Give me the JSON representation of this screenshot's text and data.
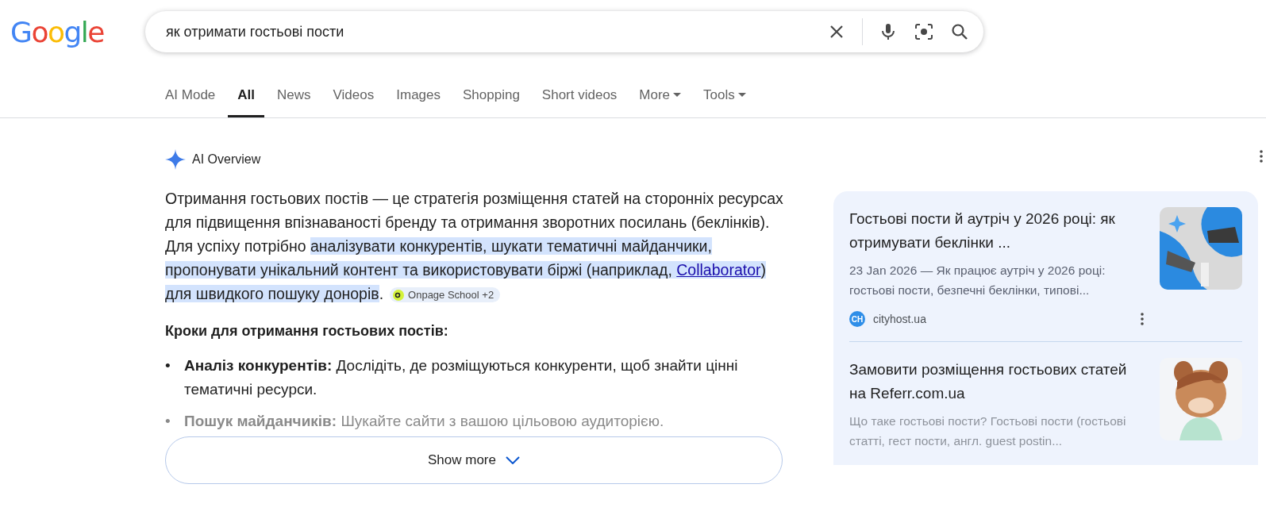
{
  "logo": [
    {
      "letter": "G",
      "color": "#4285f4"
    },
    {
      "letter": "o",
      "color": "#ea4335"
    },
    {
      "letter": "o",
      "color": "#fbbc05"
    },
    {
      "letter": "g",
      "color": "#4285f4"
    },
    {
      "letter": "l",
      "color": "#34a853"
    },
    {
      "letter": "e",
      "color": "#ea4335"
    }
  ],
  "search": {
    "value": "як отримати гостьові пости"
  },
  "tabs": [
    {
      "label": "AI Mode",
      "selected": false,
      "dropdown": false
    },
    {
      "label": "All",
      "selected": true,
      "dropdown": false
    },
    {
      "label": "News",
      "selected": false,
      "dropdown": false
    },
    {
      "label": "Videos",
      "selected": false,
      "dropdown": false
    },
    {
      "label": "Images",
      "selected": false,
      "dropdown": false
    },
    {
      "label": "Shopping",
      "selected": false,
      "dropdown": false
    },
    {
      "label": "Short videos",
      "selected": false,
      "dropdown": false
    },
    {
      "label": "More",
      "selected": false,
      "dropdown": true
    },
    {
      "label": "Tools",
      "selected": false,
      "dropdown": true
    }
  ],
  "ai_overview": {
    "title": "AI Overview",
    "paragraph": [
      {
        "text": "Отримання гостьових постів — це стратегія розміщення статей на сторонніх ресурсах для підвищення впізнаваності бренду та отримання зворотних посилань (беклінків). Для успіху потрібно ",
        "highlighted": false,
        "link": false
      },
      {
        "text": "аналізувати конкурентів, шукати тематичні майданчики, пропонувати унікальний контент та використовувати біржі (наприклад, ",
        "highlighted": true,
        "link": false
      },
      {
        "text": "Collaborator",
        "highlighted": true,
        "link": true
      },
      {
        "text": ") для швидкого пошуку донорів",
        "highlighted": true,
        "link": false
      },
      {
        "text": ".",
        "highlighted": false,
        "link": false
      }
    ],
    "citation": "Onpage School +2",
    "heading": "Кроки для отримання гостьових постів:",
    "bullets": [
      {
        "marker": "•",
        "bold": "Аналіз конкурентів:",
        "text": "Дослідіть, де розміщуються конкуренти, щоб знайти цінні тематичні ресурси.",
        "faded": false
      },
      {
        "marker": "•",
        "bold": "Пошук майданчиків:",
        "text": "Шукайте сайти з вашою цільовою аудиторією.",
        "faded": true
      }
    ],
    "show_more": "Show more"
  },
  "sources": [
    {
      "title": "Гостьові пости й аутріч у 2026 році: як отримувати беклінки ...",
      "snippet": "23 Jan 2026 — Як працює аутріч у 2026 році: гостьові пости, безпечні беклінки, типові...",
      "site": "cityhost.ua",
      "favicon": "CH",
      "faded": false
    },
    {
      "title": "Замовити розміщення гостьових статей на Referr.com.ua",
      "snippet": "Що таке гостьові пости? Гостьові пости (гостьові статті, гест пости, англ. guest postin...",
      "faded": true
    }
  ]
}
